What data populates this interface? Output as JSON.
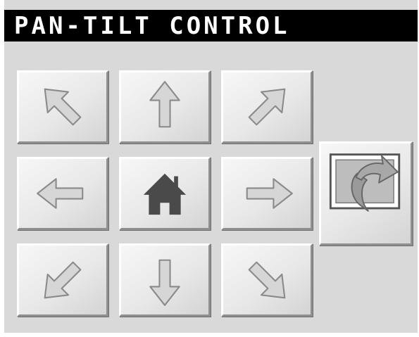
{
  "title": "PAN-TILT CONTROL",
  "colors": {
    "panel": "#d9d9d9",
    "titlebar": "#000000",
    "title_text": "#ffffff",
    "home_icon": "#4a4a4a",
    "arrow_fill": "#d6d6d6",
    "arrow_outline": "#8a8a8a"
  },
  "controls": {
    "up_left": {
      "icon": "arrow-up-left-icon"
    },
    "up": {
      "icon": "arrow-up-icon"
    },
    "up_right": {
      "icon": "arrow-up-right-icon"
    },
    "left": {
      "icon": "arrow-left-icon"
    },
    "home": {
      "icon": "home-icon"
    },
    "right": {
      "icon": "arrow-right-icon"
    },
    "down_left": {
      "icon": "arrow-down-left-icon"
    },
    "down": {
      "icon": "arrow-down-icon"
    },
    "down_right": {
      "icon": "arrow-down-right-icon"
    },
    "refresh": {
      "icon": "refresh-icon"
    }
  }
}
